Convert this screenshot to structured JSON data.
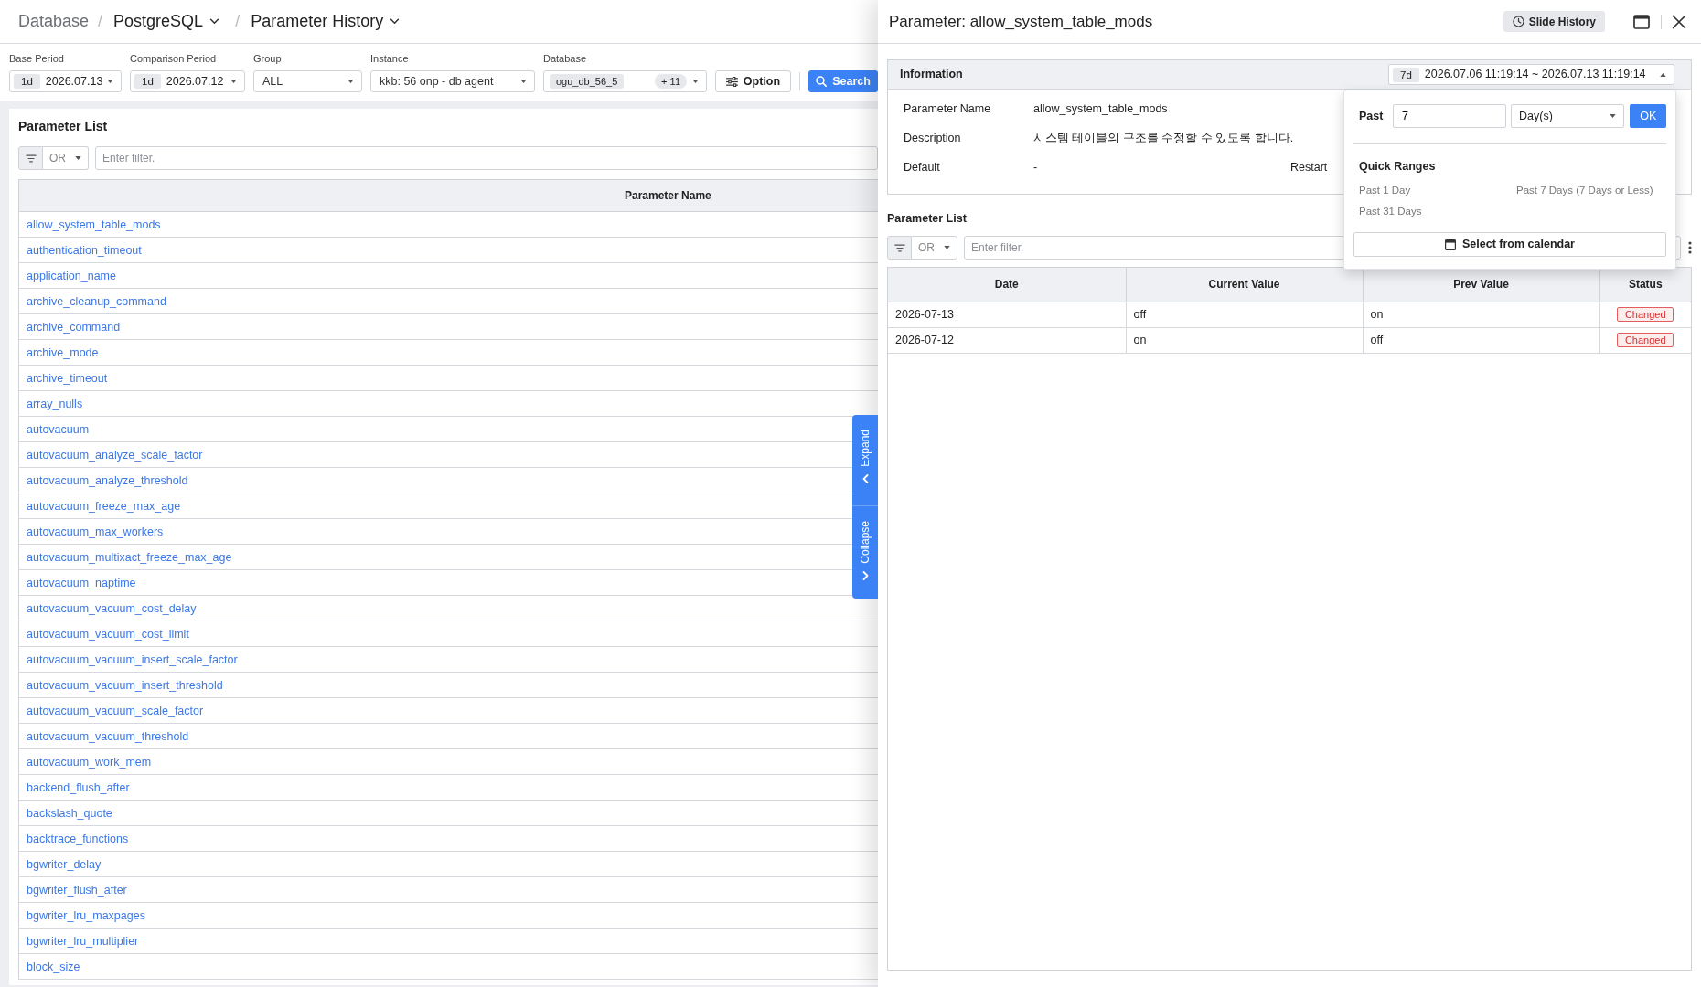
{
  "breadcrumb": [
    {
      "label": "Database",
      "kind": "link"
    },
    {
      "label": "PostgreSQL",
      "kind": "dropdown",
      "separator": "/"
    },
    {
      "label": "Parameter History",
      "kind": "dropdown",
      "separator": "/"
    }
  ],
  "filters": [
    {
      "label": "Base Period",
      "kind": "period",
      "badge": "1d",
      "value": "2026.07.13"
    },
    {
      "label": "Comparison Period",
      "kind": "period",
      "badge": "1d",
      "value": "2026.07.12"
    },
    {
      "label": "Group",
      "kind": "select",
      "value": "ALL"
    },
    {
      "label": "Instance",
      "kind": "select",
      "value": "kkb: 56 onp - db agent"
    },
    {
      "label": "Database",
      "kind": "multi",
      "value": "ogu_db_56_5",
      "count": "+ 11"
    }
  ],
  "actions": {
    "option": "Option",
    "search": "Search"
  },
  "parameter_list": {
    "title": "Parameter List",
    "filter": {
      "operator": "OR",
      "placeholder": "Enter filter."
    },
    "column": "Parameter Name",
    "rows": [
      "allow_system_table_mods",
      "authentication_timeout",
      "application_name",
      "archive_cleanup_command",
      "archive_command",
      "archive_mode",
      "archive_timeout",
      "array_nulls",
      "autovacuum",
      "autovacuum_analyze_scale_factor",
      "autovacuum_analyze_threshold",
      "autovacuum_freeze_max_age",
      "autovacuum_max_workers",
      "autovacuum_multixact_freeze_max_age",
      "autovacuum_naptime",
      "autovacuum_vacuum_cost_delay",
      "autovacuum_vacuum_cost_limit",
      "autovacuum_vacuum_insert_scale_factor",
      "autovacuum_vacuum_insert_threshold",
      "autovacuum_vacuum_scale_factor",
      "autovacuum_vacuum_threshold",
      "autovacuum_work_mem",
      "backend_flush_after",
      "backslash_quote",
      "backtrace_functions",
      "bgwriter_delay",
      "bgwriter_flush_after",
      "bgwriter_lru_maxpages",
      "bgwriter_lru_multiplier",
      "block_size"
    ]
  },
  "side_tabs": [
    {
      "label": "Expand",
      "kind": "expand"
    },
    {
      "label": "Collapse",
      "kind": "collapse"
    }
  ],
  "panel": {
    "title": "Parameter: allow_system_table_mods",
    "history_button": "Slide History",
    "information": {
      "title": "Information",
      "range": {
        "badge": "7d",
        "value": "2026.07.06 11:19:14 ~ 2026.07.13 11:19:14",
        "expanded": true
      },
      "fields": [
        {
          "label": "Parameter Name",
          "value": "allow_system_table_mods"
        },
        {
          "label": "Description",
          "value": "시스템 테이블의 구조를 수정할 수 있도록 합니다."
        },
        {
          "label": "Default",
          "value": "-",
          "extra_label": "Restart"
        }
      ]
    },
    "range_popover": {
      "past_label": "Past",
      "past_value": "7",
      "unit": "Day(s)",
      "ok": "OK",
      "quick_title": "Quick Ranges",
      "quick_ranges": [
        "Past 1 Day",
        "Past 7 Days (7 Days or Less)",
        "Past 31 Days"
      ],
      "calendar_button": "Select from calendar"
    },
    "history": {
      "title": "Parameter List",
      "filter": {
        "operator": "OR",
        "placeholder": "Enter filter."
      },
      "columns": [
        "Date",
        "Current Value",
        "Prev Value",
        "Status"
      ],
      "rows": [
        {
          "date": "2026-07-13",
          "current_value": "off",
          "prev_value": "on",
          "status": "Changed"
        },
        {
          "date": "2026-07-12",
          "current_value": "on",
          "prev_value": "off",
          "status": "Changed"
        }
      ]
    }
  }
}
